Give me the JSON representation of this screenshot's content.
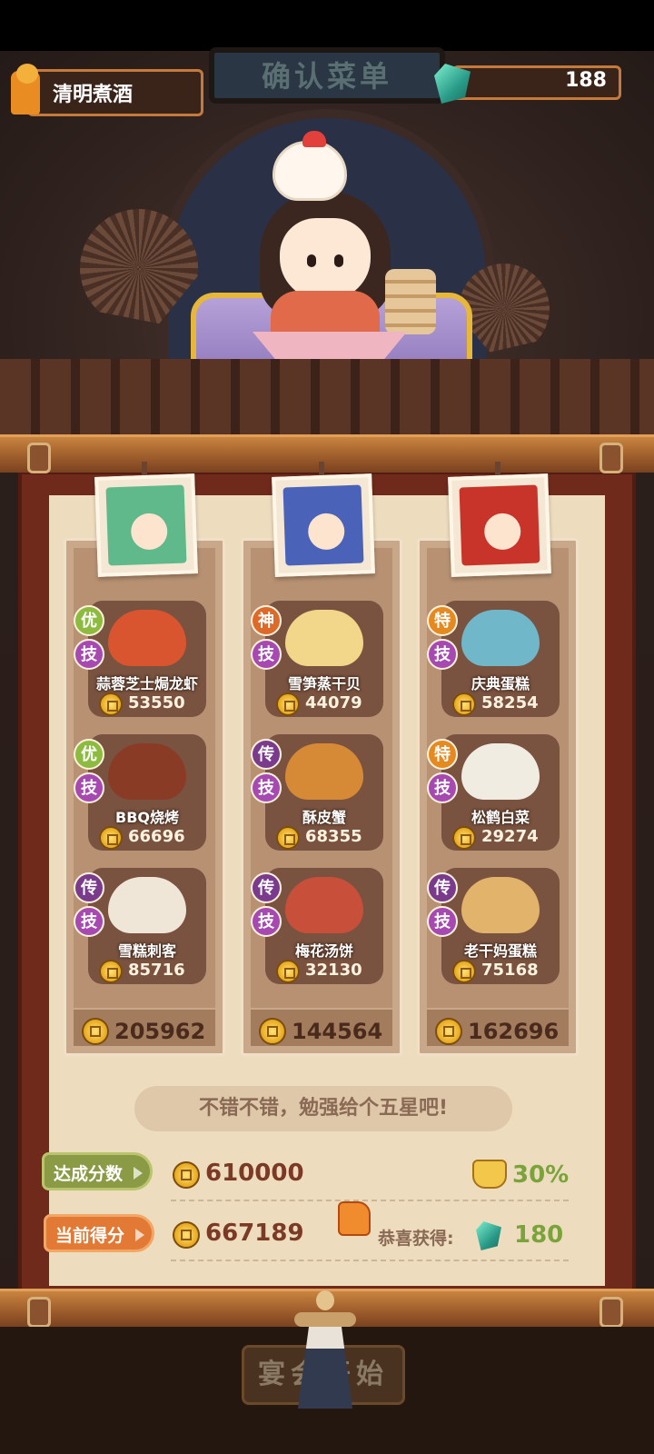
{
  "header": {
    "level_title": "清明煮酒",
    "gem_count": "188",
    "sign_text": "确认菜单"
  },
  "columns": [
    {
      "total": "205962",
      "dishes": [
        {
          "badge": "优",
          "skill": "技",
          "name": "蒜蓉芝士焗龙虾",
          "price": "53550",
          "food_color": "#d9552f"
        },
        {
          "badge": "优",
          "skill": "技",
          "name": "BBQ烧烤",
          "price": "66696",
          "food_color": "#8a3b25"
        },
        {
          "badge": "传",
          "skill": "技",
          "name": "雪糕刺客",
          "price": "85716",
          "food_color": "#efe6d8"
        }
      ],
      "portrait_color": "#5fb98a"
    },
    {
      "total": "144564",
      "dishes": [
        {
          "badge": "神",
          "skill": "技",
          "name": "雪笋蒸干贝",
          "price": "44079",
          "food_color": "#f2d78a"
        },
        {
          "badge": "传",
          "skill": "技",
          "name": "酥皮蟹",
          "price": "68355",
          "food_color": "#d78a35"
        },
        {
          "badge": "传",
          "skill": "技",
          "name": "梅花汤饼",
          "price": "32130",
          "food_color": "#c8503a"
        }
      ],
      "portrait_color": "#4a63b8"
    },
    {
      "total": "162696",
      "dishes": [
        {
          "badge": "特",
          "skill": "技",
          "name": "庆典蛋糕",
          "price": "58254",
          "food_color": "#6fb7c9"
        },
        {
          "badge": "特",
          "skill": "技",
          "name": "松鹤白菜",
          "price": "29274",
          "food_color": "#f1ece2"
        },
        {
          "badge": "传",
          "skill": "技",
          "name": "老干妈蛋糕",
          "price": "75168",
          "food_color": "#e2b36a"
        }
      ],
      "portrait_color": "#c9342a"
    }
  ],
  "comment": "不错不错，勉强给个五星吧!",
  "target": {
    "label": "达成分数",
    "value": "610000",
    "bonus_pct": "30%"
  },
  "current": {
    "label": "当前得分",
    "value": "667189",
    "reward_label": "恭喜获得:",
    "reward_value": "180"
  },
  "start_button": "宴会开始",
  "colors": {
    "accent_green": "#7ba33b",
    "board_red": "#6f2a1c",
    "paper": "#eedcbe"
  }
}
